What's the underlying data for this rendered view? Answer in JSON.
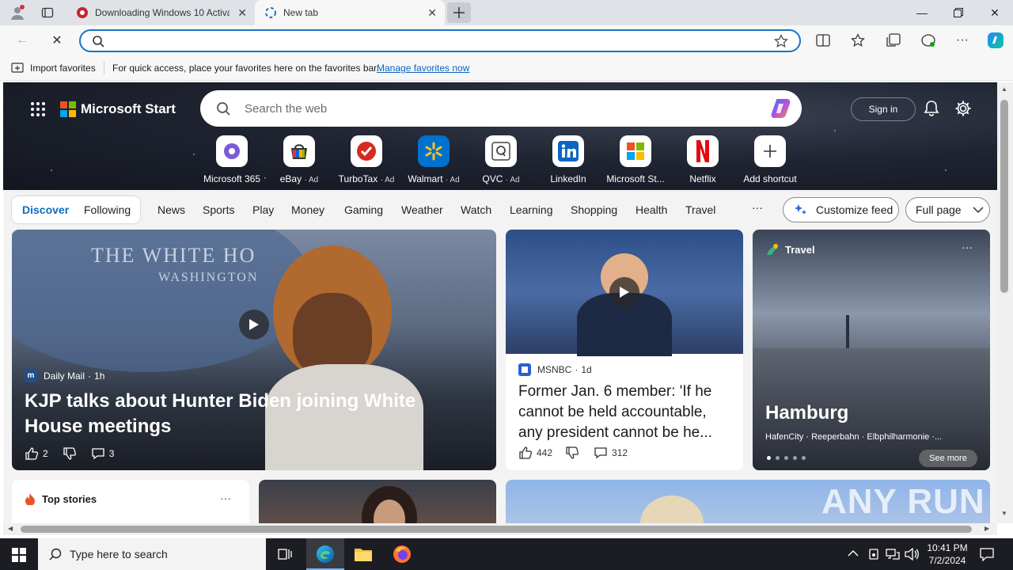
{
  "browser": {
    "tabs": [
      {
        "title": "Downloading Windows 10 Activa",
        "active": false
      },
      {
        "title": "New tab",
        "active": true
      }
    ],
    "address_placeholder": "",
    "favorites_bar": {
      "import_label": "Import favorites",
      "message": "For quick access, place your favorites here on the favorites bar.",
      "manage_link": "Manage favorites now"
    }
  },
  "header": {
    "brand": "Microsoft Start",
    "search_placeholder": "Search the web",
    "signin": "Sign in"
  },
  "shortcuts": [
    {
      "label": "Microsoft 365",
      "ad": ""
    },
    {
      "label": "eBay",
      "ad": "· Ad"
    },
    {
      "label": "TurboTax",
      "ad": "· Ad"
    },
    {
      "label": "Walmart",
      "ad": "· Ad"
    },
    {
      "label": "QVC",
      "ad": "· Ad"
    },
    {
      "label": "LinkedIn",
      "ad": ""
    },
    {
      "label": "Microsoft St...",
      "ad": ""
    },
    {
      "label": "Netflix",
      "ad": ""
    },
    {
      "label": "Add shortcut",
      "ad": ""
    }
  ],
  "nav": {
    "discover": "Discover",
    "following": "Following",
    "items": [
      "News",
      "Sports",
      "Play",
      "Money",
      "Gaming",
      "Weather",
      "Watch",
      "Learning",
      "Shopping",
      "Health",
      "Travel"
    ],
    "more": "···",
    "customize": "Customize feed",
    "layout": "Full page"
  },
  "cards": {
    "main": {
      "source": "Daily Mail",
      "age": "1h",
      "headline": "KJP talks about Hunter Biden joining White House meetings",
      "likes": "2",
      "comments": "3"
    },
    "second": {
      "source": "MSNBC",
      "age": "1d",
      "headline": "Former Jan. 6 member: 'If he cannot be held accountable, any president cannot be he...",
      "likes": "442",
      "comments": "312"
    },
    "travel": {
      "category": "Travel",
      "city": "Hamburg",
      "places": "HafenCity · Reeperbahn · Elbphilharmonie ·...",
      "see_more": "See more"
    },
    "top_stories": {
      "title": "Top stories",
      "more": "···"
    }
  },
  "watermark": "ANY RUN",
  "taskbar": {
    "search_placeholder": "Type here to search",
    "time": "10:41 PM",
    "date": "7/2/2024"
  }
}
